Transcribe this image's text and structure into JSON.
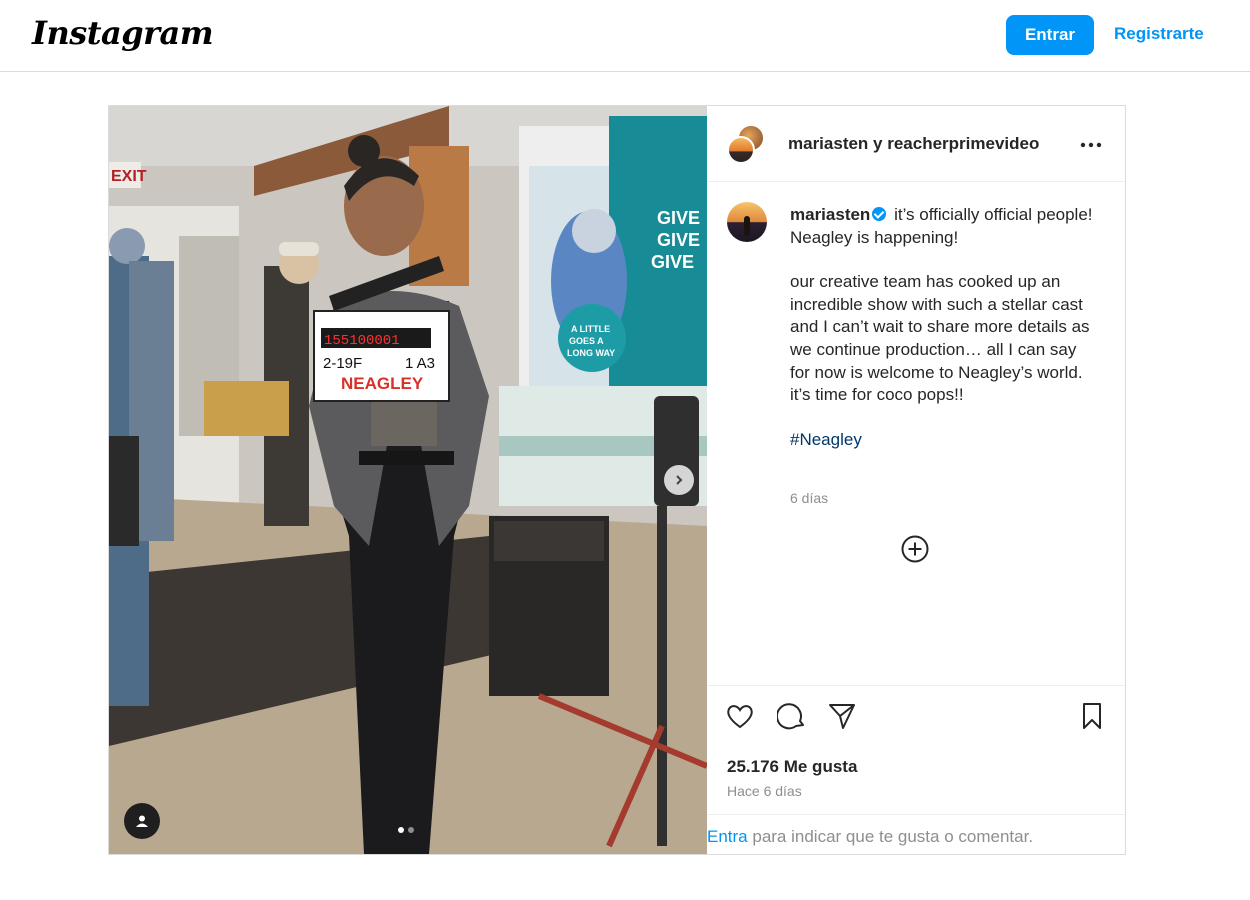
{
  "app": {
    "logo": "Instagram"
  },
  "header": {
    "login_label": "Entrar",
    "signup_label": "Registrarte",
    "accent_color": "#0095f6"
  },
  "post": {
    "header_users": "mariasten y reacherprimevideo",
    "caption": {
      "username": "mariasten",
      "verified": true,
      "line1": "it’s officially official people! Neagley is happening!",
      "paragraph": "our creative team has cooked up an incredible show with such a stellar cast and I can’t wait to share more details as we continue production… all I can say for now is welcome to Neagley’s world. it’s time for coco pops!!",
      "hashtag": "#Neagley",
      "time": "6 días"
    },
    "photo": {
      "slate_counter": "155100001",
      "slate_scene": "2-19F",
      "slate_take": "1 A3",
      "slate_title": "NEAGLEY",
      "exit_sign": "EXIT",
      "poster_line1": "GIVE",
      "poster_line2": "GIVE",
      "poster_line3": "GIVE",
      "poster_badge": "A LITTLE GOES A LONG WAY",
      "carousel_count": 2,
      "carousel_active": 1
    },
    "icons": {
      "more": "more-options-icon",
      "like": "heart-icon",
      "comment": "comment-icon",
      "share": "share-icon",
      "save": "bookmark-icon",
      "load_more": "plus-circle-icon",
      "user_tag": "user-tag-icon",
      "next": "chevron-right-icon"
    },
    "likes": "25.176 Me gusta",
    "time_ago": "Hace 6 días",
    "footer": {
      "login_link": "Entra",
      "footer_text": " para indicar que te gusta o comentar."
    }
  }
}
